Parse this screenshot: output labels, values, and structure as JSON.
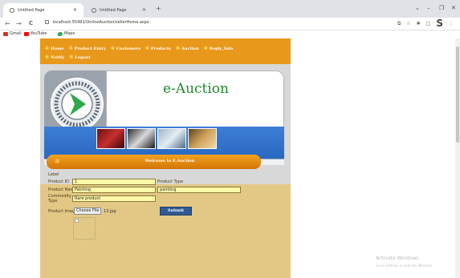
{
  "browser": {
    "tabs": [
      {
        "title": "Untitled Page"
      },
      {
        "title": "Untitled Page"
      }
    ],
    "new_tab": "+",
    "win_controls": [
      "⌄",
      "–",
      "❐",
      "✕"
    ],
    "nav": {
      "back": "←",
      "forward": "→",
      "reload": "C"
    },
    "url": "localhost:55491/OnlineAuction/sellerHome.aspx",
    "bookmarks": [
      "Gmail",
      "YouTube",
      "Maps"
    ],
    "right_icons": [
      "⧉",
      "☆",
      "✱",
      "□",
      "S",
      "⋮"
    ]
  },
  "site": {
    "menu_row1": [
      "Home",
      "Product Entry",
      "Customers",
      "Products",
      "Auction",
      "Reply_Info"
    ],
    "menu_row2": [
      "Notify",
      "Logout"
    ],
    "title": "e-Auction",
    "welcome": "Welcome to E.Auction"
  },
  "form": {
    "label": "Label",
    "product_id_label": "Product ID",
    "product_id_value": "1",
    "product_type_label": "Product Type",
    "product_name_label": "Product Name",
    "product_name_value": "Painting",
    "product_type_value": "painting",
    "commodity_label_1": "Commodity",
    "commodity_label_2": "Type",
    "commodity_value": "Rare product",
    "product_image_label": "Product Image",
    "choose_file": "Choose File",
    "file_name": "13.jpg",
    "submit": "Submit"
  },
  "os": {
    "activate_title": "Activate Windows",
    "activate_sub": "Go to Settings to activate Windows."
  },
  "colors": {
    "menu_orange": "#e8981b",
    "page_tan": "#e3c885",
    "title_green": "#1e8a2e",
    "submit_blue": "#2f5a93"
  }
}
